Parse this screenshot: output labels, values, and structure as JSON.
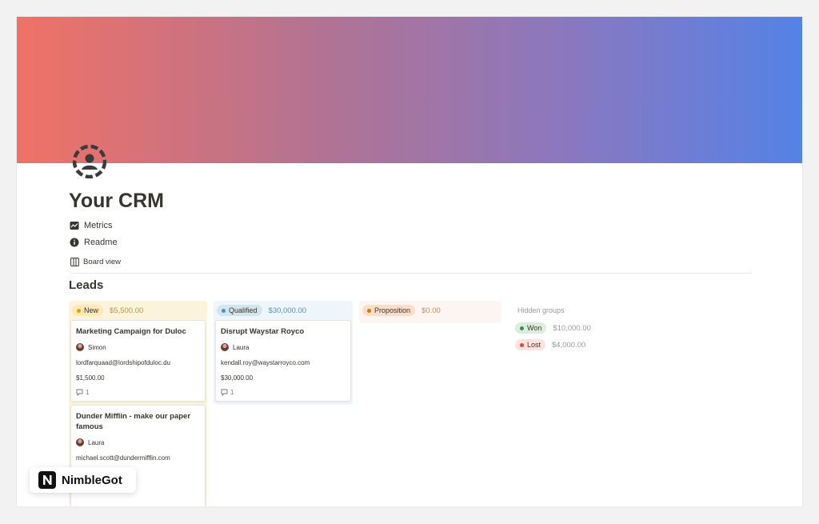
{
  "page": {
    "title": "Your CRM",
    "links": [
      {
        "label": "Metrics",
        "icon": "chart-icon"
      },
      {
        "label": "Readme",
        "icon": "info-icon"
      }
    ],
    "view_tab": "Board view"
  },
  "database": {
    "title": "Leads",
    "columns": [
      {
        "status": "New",
        "sum": "$5,500.00",
        "colors": {
          "bg": "#fbf3db",
          "pill": "#fde8b6",
          "dot": "#d9a01c",
          "sum": "#c29343"
        },
        "cards": [
          {
            "title": "Marketing Campaign for Duloc",
            "person": "Simon",
            "email": "lordfarquaad@lordshipofduloc.du",
            "amount": "$1,500.00",
            "comments": "1"
          },
          {
            "title": "Dunder Mifflin - make our paper famous",
            "person": "Laura",
            "email": "michael.scott@dundermifflin.com",
            "amount": "",
            "comments": ""
          }
        ]
      },
      {
        "status": "Qualified",
        "sum": "$30,000.00",
        "colors": {
          "bg": "#eef6fb",
          "pill": "#d3e5ef",
          "dot": "#4d8fbf",
          "sum": "#5a91b5"
        },
        "cards": [
          {
            "title": "Disrupt Waystar Royco",
            "person": "Laura",
            "email": "kendall.roy@waystarroyco.com",
            "amount": "$30,000.00",
            "comments": "1"
          }
        ]
      },
      {
        "status": "Proposition",
        "sum": "$0.00",
        "colors": {
          "bg": "#fcf5f1",
          "pill": "#fadec9",
          "dot": "#d9730d",
          "sum": "#c98a5f"
        },
        "cards": []
      }
    ],
    "hidden_groups": {
      "title": "Hidden groups",
      "items": [
        {
          "status": "Won",
          "sum": "$10,000.00",
          "colors": {
            "pill": "#dbeddb",
            "dot": "#448361"
          }
        },
        {
          "status": "Lost",
          "sum": "$4,000.00",
          "colors": {
            "pill": "#ffe2dd",
            "dot": "#d44c47"
          }
        }
      ]
    }
  },
  "brand": {
    "name": "NimbleGot",
    "icon": "n-logo-icon"
  }
}
